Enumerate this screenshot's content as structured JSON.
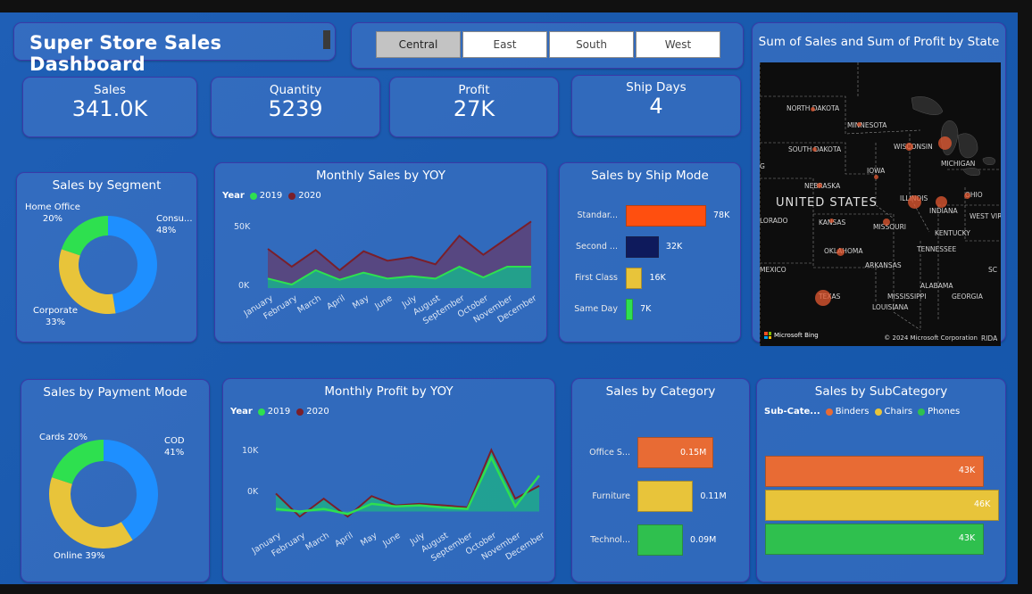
{
  "dashboard_title": "Super Store Sales Dashboard",
  "region_slicer": {
    "options": [
      "Central",
      "East",
      "South",
      "West"
    ],
    "selected": "Central"
  },
  "kpis": {
    "sales": {
      "label": "Sales",
      "value": "341.0K"
    },
    "quantity": {
      "label": "Quantity",
      "value": "5239"
    },
    "profit": {
      "label": "Profit",
      "value": "27K"
    },
    "ship_days": {
      "label": "Ship Days",
      "value": "4"
    }
  },
  "map": {
    "title": "Sum of Sales and Sum of Profit by State",
    "country_label": "UNITED STATES",
    "state_labels": [
      "NORTH DAKOTA",
      "MINNESOTA",
      "SOUTH DAKOTA",
      "WISCONSIN",
      "MICHIGAN",
      "IOWA",
      "NEBRASKA",
      "ILLINOIS",
      "OHIO",
      "INDIANA",
      "KANSAS",
      "MISSOURI",
      "KENTUCKY",
      "WEST VIR",
      "TENNESSEE",
      "OKLAHOMA",
      "ARKANSAS",
      "ALABAMA",
      "MISSISSIPPI",
      "GEORGIA",
      "TEXAS",
      "LOUISIANA",
      "SC",
      "LORADO",
      "MEXICO",
      "G",
      "RIDA"
    ],
    "bing_label": "Microsoft Bing",
    "copyright": "© 2024 Microsoft Corporation",
    "bubble_color": "#e25a35"
  },
  "sales_by_segment": {
    "title": "Sales by Segment",
    "chart_data": {
      "type": "pie",
      "categories": [
        "Consumer",
        "Corporate",
        "Home Office"
      ],
      "display_labels": [
        "Consu...",
        "Corporate",
        "Home Office"
      ],
      "percent_labels": [
        "48%",
        "33%",
        "20%"
      ],
      "values": [
        48,
        33,
        20
      ],
      "colors": [
        "#1e8fff",
        "#e8c43a",
        "#2ee04f"
      ]
    }
  },
  "monthly_sales": {
    "title": "Monthly Sales by YOY",
    "legend_title": "Year",
    "chart_data": {
      "type": "area",
      "categories": [
        "January",
        "February",
        "March",
        "April",
        "May",
        "June",
        "July",
        "August",
        "September",
        "October",
        "November",
        "December"
      ],
      "series": [
        {
          "name": "2019",
          "color": "#2ee04f",
          "values": [
            8000,
            3000,
            15000,
            7000,
            13000,
            8000,
            10000,
            8000,
            18000,
            9000,
            18000,
            18000
          ]
        },
        {
          "name": "2020",
          "color": "#7a1f2a",
          "values": [
            33000,
            18000,
            32000,
            15000,
            31000,
            23000,
            26000,
            20000,
            44000,
            28000,
            42000,
            56000
          ]
        }
      ],
      "yticks": [
        "0K",
        "50K"
      ],
      "ylim": [
        0,
        60000
      ]
    }
  },
  "ship_mode": {
    "title": "Sales by Ship Mode",
    "chart_data": {
      "type": "bar",
      "categories": [
        "Standar...",
        "Second ...",
        "First Class",
        "Same Day"
      ],
      "values": [
        78,
        32,
        16,
        7
      ],
      "value_labels": [
        "78K",
        "32K",
        "16K",
        "7K"
      ],
      "colors": [
        "#ff4f0f",
        "#0e1a5c",
        "#e8c43a",
        "#2ee04f"
      ]
    }
  },
  "payment_mode": {
    "title": "Sales by Payment Mode",
    "chart_data": {
      "type": "pie",
      "categories": [
        "COD",
        "Online",
        "Cards"
      ],
      "display_labels": [
        "COD",
        "Online 39%",
        "Cards 20%"
      ],
      "percent_labels": [
        "41%",
        "",
        ""
      ],
      "values": [
        41,
        39,
        20
      ],
      "colors": [
        "#1e8fff",
        "#e8c43a",
        "#2ee04f"
      ]
    }
  },
  "monthly_profit": {
    "title": "Monthly Profit by YOY",
    "legend_title": "Year",
    "chart_data": {
      "type": "line",
      "categories": [
        "January",
        "February",
        "March",
        "April",
        "May",
        "June",
        "July",
        "August",
        "September",
        "October",
        "November",
        "December"
      ],
      "series": [
        {
          "name": "2019",
          "color": "#2ee04f",
          "values": [
            500,
            0,
            500,
            -500,
            1500,
            1000,
            1200,
            800,
            500,
            10500,
            1000,
            7000
          ]
        },
        {
          "name": "2020",
          "color": "#7a1f2a",
          "values": [
            3500,
            -1000,
            2500,
            -1000,
            3000,
            1200,
            1500,
            1200,
            800,
            12000,
            2500,
            5000
          ]
        }
      ],
      "yticks": [
        "0K",
        "10K"
      ],
      "ylim": [
        -2000,
        14000
      ]
    }
  },
  "category": {
    "title": "Sales by Category",
    "chart_data": {
      "type": "bar",
      "categories": [
        "Office S...",
        "Furniture",
        "Technol..."
      ],
      "values": [
        0.15,
        0.11,
        0.09
      ],
      "value_labels": [
        "0.15M",
        "0.11M",
        "0.09M"
      ],
      "colors": [
        "#e86b34",
        "#e8c43a",
        "#2fc04e"
      ]
    }
  },
  "subcategory": {
    "title": "Sales by SubCategory",
    "legend_title": "Sub-Cate...",
    "chart_data": {
      "type": "bar",
      "categories": [
        "Binders",
        "Chairs",
        "Phones"
      ],
      "values": [
        43,
        46,
        43
      ],
      "value_labels": [
        "43K",
        "46K",
        "43K"
      ],
      "colors": [
        "#e86b34",
        "#e8c43a",
        "#2fc04e"
      ]
    }
  }
}
